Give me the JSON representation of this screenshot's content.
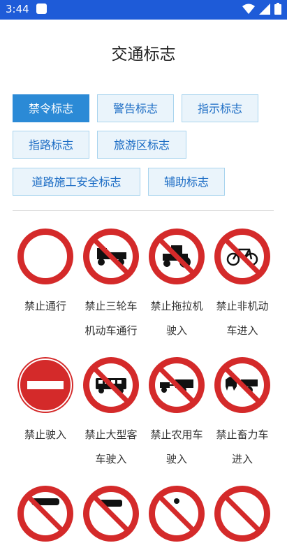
{
  "status_bar": {
    "time": "3:44"
  },
  "title": "交通标志",
  "tabs": [
    {
      "label": "禁令标志",
      "active": true
    },
    {
      "label": "警告标志",
      "active": false
    },
    {
      "label": "指示标志",
      "active": false
    },
    {
      "label": "指路标志",
      "active": false
    },
    {
      "label": "旅游区标志",
      "active": false
    },
    {
      "label": "道路施工安全标志",
      "active": false
    },
    {
      "label": "辅助标志",
      "active": false
    }
  ],
  "signs": [
    {
      "label": "禁止通行",
      "icon": "no-entry-all-icon"
    },
    {
      "label": "禁止三轮车\n机动车通行",
      "icon": "no-motor-tricycle-icon"
    },
    {
      "label": "禁止拖拉机\n驶入",
      "icon": "no-tractor-icon"
    },
    {
      "label": "禁止非机动\n车进入",
      "icon": "no-bicycle-icon"
    },
    {
      "label": "禁止驶入",
      "icon": "no-entry-icon"
    },
    {
      "label": "禁止大型客\n车驶入",
      "icon": "no-bus-icon"
    },
    {
      "label": "禁止农用车\n驶入",
      "icon": "no-farm-vehicle-icon"
    },
    {
      "label": "禁止畜力车\n进入",
      "icon": "no-animal-cart-icon"
    }
  ],
  "colors": {
    "status_bar": "#1e5bd8",
    "tab_active": "#2b8ad6",
    "sign_red": "#d42a2a"
  }
}
